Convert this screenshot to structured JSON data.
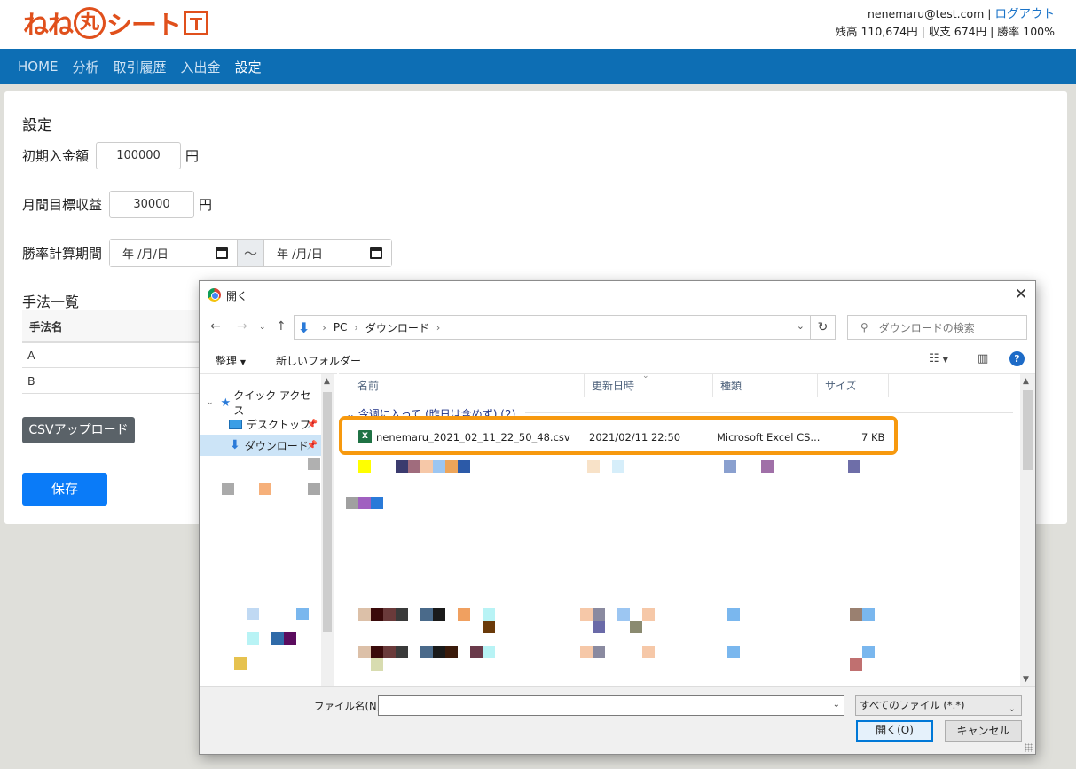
{
  "header": {
    "logo_text": "ねね",
    "logo_circle": "丸",
    "logo_suffix": "シート",
    "user_email": "nenemaru@test.com",
    "separator": "|",
    "logout": "ログアウト",
    "stats": "残高 110,674円 | 収支 674円 | 勝率 100%"
  },
  "nav": {
    "items": [
      "HOME",
      "分析",
      "取引履歴",
      "入出金",
      "設定"
    ],
    "active": "設定"
  },
  "settings": {
    "title": "設定",
    "initial_deposit_label": "初期入金額",
    "initial_deposit_value": "100000",
    "monthly_target_label": "月間目標収益",
    "monthly_target_value": "30000",
    "unit": "円",
    "win_period_label": "勝率計算期間",
    "date_placeholder": "年 /月/日",
    "tilde": "～",
    "methods_title": "手法一覧",
    "methods_header": "手法名",
    "methods": [
      "A",
      "B"
    ],
    "csv_button": "CSVアップロード",
    "save_button": "保存"
  },
  "dialog": {
    "title": "開く",
    "close": "✕",
    "breadcrumb": [
      "PC",
      "ダウンロード"
    ],
    "search_placeholder": "ダウンロードの検索",
    "organize": "整理",
    "new_folder": "新しいフォルダー",
    "help": "?",
    "tree": {
      "quick_access": "クイック アクセス",
      "desktop": "デスクトップ",
      "downloads": "ダウンロード"
    },
    "columns": {
      "name": "名前",
      "modified": "更新日時",
      "type": "種類",
      "size": "サイズ"
    },
    "group_header": "今週に入って (昨日は含めず) (2)",
    "file": {
      "name": "nenemaru_2021_02_11_22_50_48.csv",
      "modified": "2021/02/11 22:50",
      "type": "Microsoft Excel CS...",
      "size": "7 KB",
      "icon_letter": "X"
    },
    "filename_label": "ファイル名(N):",
    "filename_value": "",
    "file_type": "すべてのファイル (*.*)",
    "open_button": "開く(O)",
    "cancel_button": "キャンセル"
  },
  "colors": {
    "brand": "#e0501c",
    "nav_bg": "#0d6eb4",
    "save_btn": "#0a7bf8",
    "highlight": "#f7990e",
    "excel": "#1f7244"
  }
}
